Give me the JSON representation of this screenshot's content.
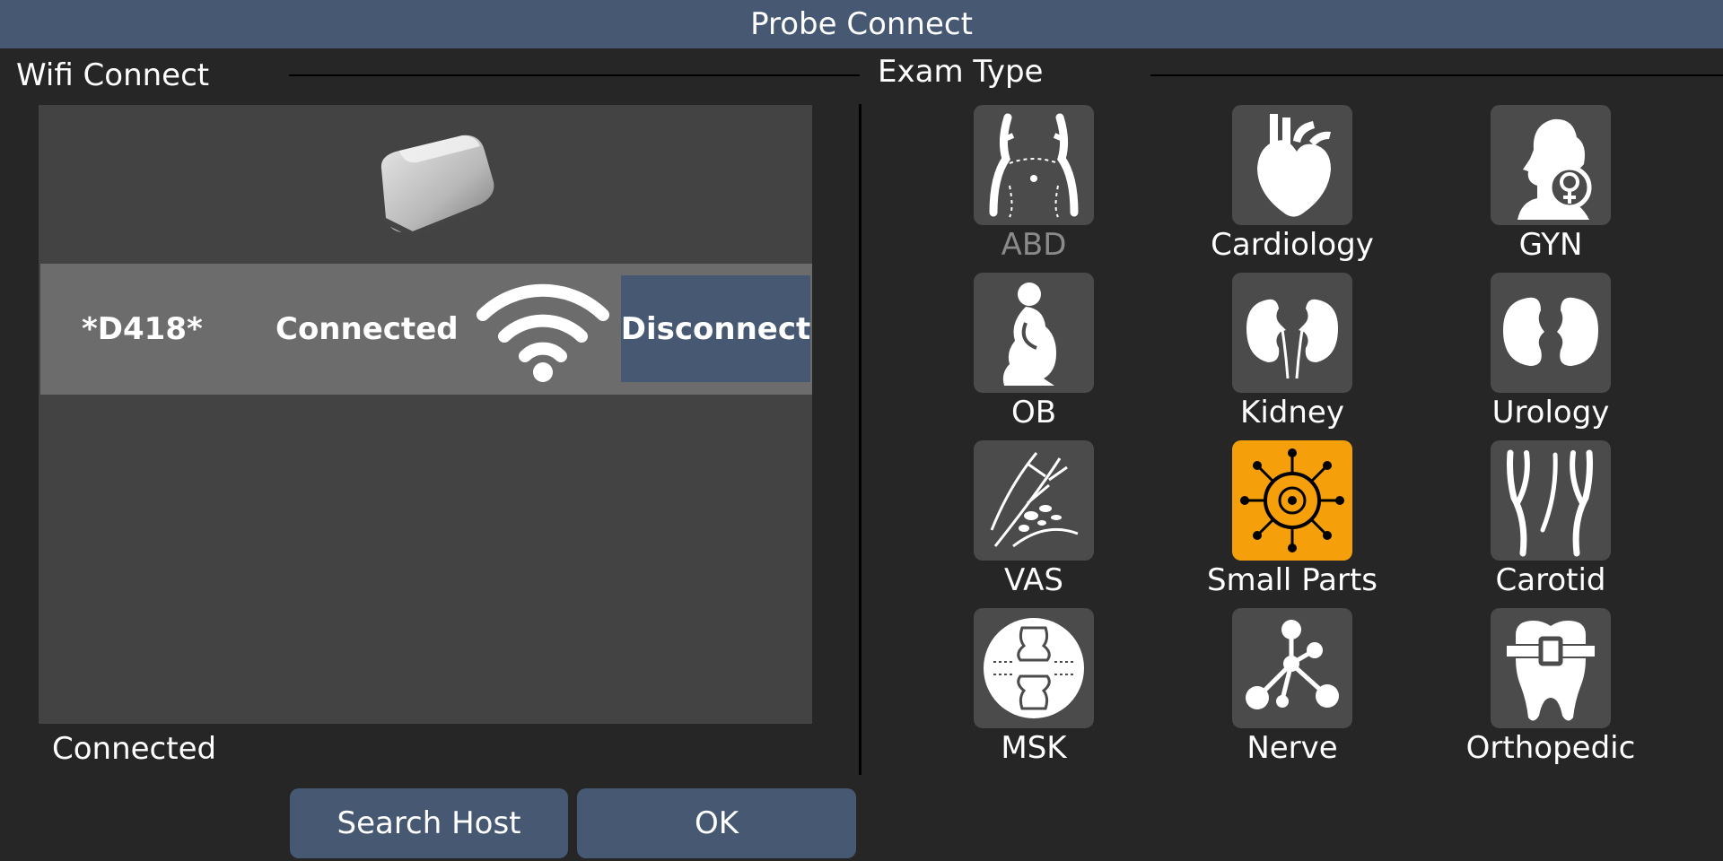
{
  "title": "Probe Connect",
  "wifi_section": {
    "label": "Wifi Connect",
    "probe": {
      "name": "*D418*",
      "status": "Connected",
      "icon": "wifi-icon",
      "disconnect_label": "Disconnect"
    },
    "connection_status": "Connected"
  },
  "exam_section": {
    "label": "Exam Type",
    "selected_color": "#f5a00a",
    "items": [
      {
        "label": "ABD",
        "icon": "abdomen-icon"
      },
      {
        "label": "Cardiology",
        "icon": "heart-icon"
      },
      {
        "label": "GYN",
        "icon": "female-head-icon"
      },
      {
        "label": "OB",
        "icon": "pregnant-woman-icon"
      },
      {
        "label": "Kidney",
        "icon": "kidneys-icon"
      },
      {
        "label": "Urology",
        "icon": "urology-icon"
      },
      {
        "label": "VAS",
        "icon": "vascular-icon"
      },
      {
        "label": "Small Parts",
        "icon": "small-parts-icon"
      },
      {
        "label": "Carotid",
        "icon": "carotid-icon"
      },
      {
        "label": "MSK",
        "icon": "joint-icon"
      },
      {
        "label": "Nerve",
        "icon": "nerve-icon"
      },
      {
        "label": "Orthopedic",
        "icon": "tooth-icon"
      }
    ]
  },
  "buttons": {
    "search_host": "Search Host",
    "ok": "OK"
  },
  "colors": {
    "titlebar": "#475872",
    "button": "#475872",
    "background": "#262626",
    "panel": "#434343"
  }
}
